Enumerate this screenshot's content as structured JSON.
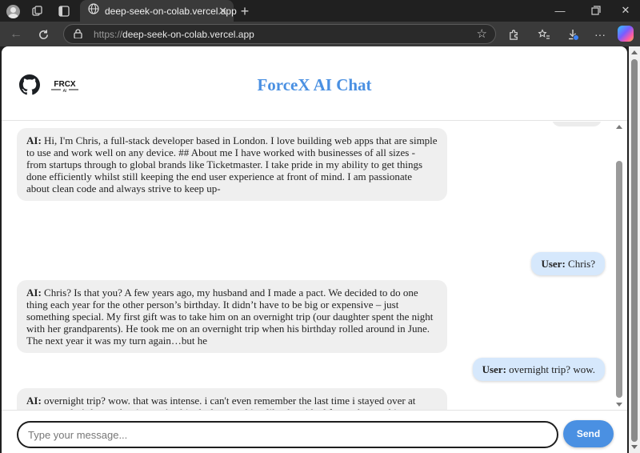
{
  "browser": {
    "tab_title": "deep-seek-on-colab.vercel.app",
    "url_protocol": "https://",
    "url_host": "deep-seek-on-colab.vercel.app",
    "icons": [
      "profile-icon",
      "workspaces-icon",
      "tab-actions-icon",
      "site-favicon",
      "close-icon",
      "new-tab-icon",
      "minimize-icon",
      "maximize-icon",
      "window-close-icon",
      "back-icon",
      "reload-icon",
      "lock-icon",
      "star-icon",
      "extensions-icon",
      "favorites-icon",
      "downloads-icon",
      "more-icon",
      "copilot-icon"
    ]
  },
  "header": {
    "title": "ForceX AI Chat",
    "logo_text": "FRCX",
    "logo_subtext": "AI"
  },
  "messages": [
    {
      "role": "ai",
      "speaker": "AI:",
      "text": " Hi, I'm Chris, a full-stack developer based in London. I love building web apps that are simple to use and work well on any device. ## About me I have worked with businesses of all sizes - from startups through to global brands like Ticketmaster. I take pride in my ability to get things done efficiently whilst still keeping the end user experience at front of mind. I am passionate about clean code and always strive to keep up-"
    },
    {
      "role": "user",
      "speaker": "User:",
      "text": " Chris?"
    },
    {
      "role": "ai",
      "speaker": "AI:",
      "text": " Chris? Is that you? A few years ago, my husband and I made a pact. We decided to do one thing each year for the other person’s birthday. It didn’t have to be big or expensive – just something special. My first gift was to take him on an overnight trip (our daughter spent the night with her grandparents). He took me on an overnight trip when his birthday rolled around in June. The next year it was my turn again…but he"
    },
    {
      "role": "user",
      "speaker": "User:",
      "text": " overnight trip? wow."
    },
    {
      "role": "ai",
      "speaker": "AI:",
      "text": " overnight trip? wow. that was intense. i can't even remember the last time i stayed over at someone else's house, but it wasn't a big deal or anything like that. i had fun and everything, which is what matters. although i do feel kind of sick now, so maybe this isn't as good an idea as it could be. oh well. we watched three movies (the first two were \"a knight's tale\" and \"bringing"
    }
  ],
  "composer": {
    "placeholder": "Type your message...",
    "send_label": "Send"
  },
  "colors": {
    "accent": "#4a90e2",
    "ai_bubble": "#efefef",
    "user_bubble": "#d6e8fc"
  }
}
